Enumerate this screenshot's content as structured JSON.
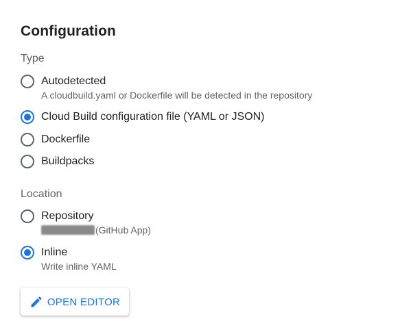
{
  "title": "Configuration",
  "type_section": {
    "label": "Type",
    "options": [
      {
        "label": "Autodetected",
        "description": "A cloudbuild.yaml or Dockerfile will be detected in the repository",
        "checked": false
      },
      {
        "label": "Cloud Build configuration file (YAML or JSON)",
        "checked": true
      },
      {
        "label": "Dockerfile",
        "checked": false
      },
      {
        "label": "Buildpacks",
        "checked": false
      }
    ]
  },
  "location_section": {
    "label": "Location",
    "options": [
      {
        "label": "Repository",
        "description_suffix": "(GitHub App)",
        "checked": false
      },
      {
        "label": "Inline",
        "description": "Write inline YAML",
        "checked": true
      }
    ]
  },
  "open_editor_button": {
    "label": "OPEN EDITOR",
    "icon": "pencil-icon"
  },
  "colors": {
    "accent": "#1a73e8",
    "text": "#202124",
    "secondary": "#5f6368"
  }
}
